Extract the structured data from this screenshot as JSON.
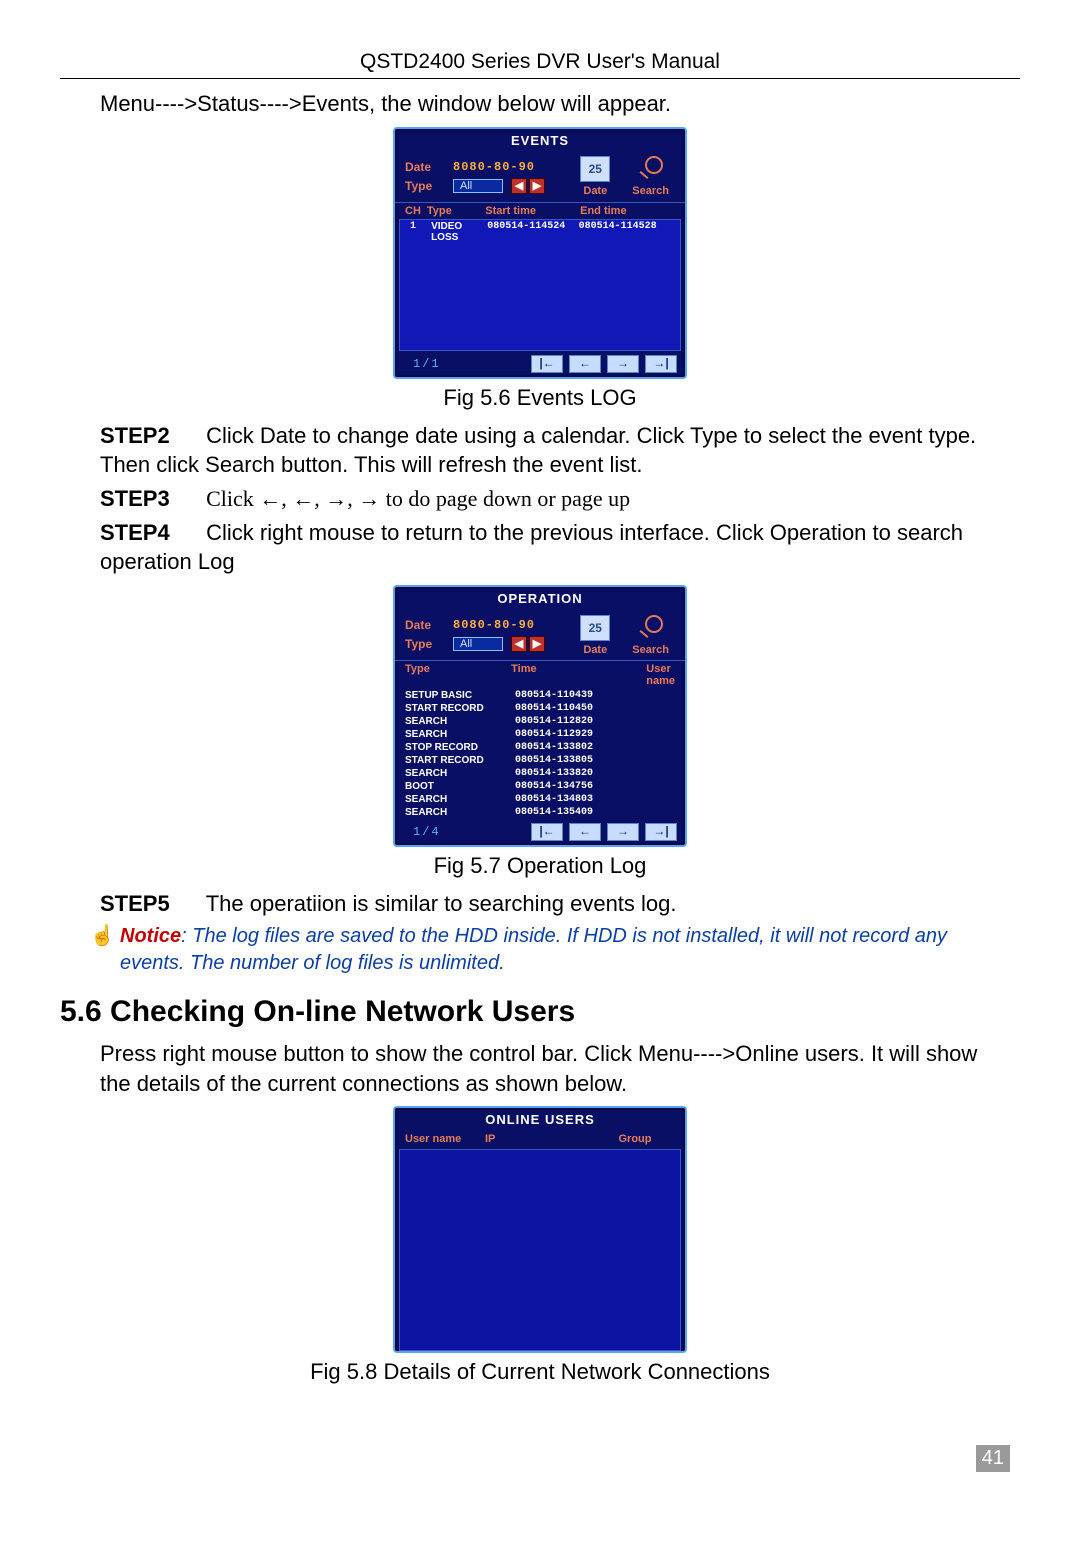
{
  "doc": {
    "header": "QSTD2400 Series DVR User's Manual",
    "intro": "Menu---->Status---->Events, the window below will appear.",
    "fig56": "Fig 5.6 Events LOG",
    "step2_label": "STEP2",
    "step2_text": "Click Date to change date using a calendar. Click Type to select the event type. Then click Search button. This will refresh the event list.",
    "step3_label": "STEP3",
    "step3_text_pre": "Click  ←,  ←,  →,  → ",
    "step3_text_post": "to do page down or page up",
    "step4_label": "STEP4",
    "step4_text": "Click right mouse to return to the previous interface. Click Operation to search operation Log",
    "fig57": "Fig 5.7 Operation Log",
    "step5_label": "STEP5",
    "step5_text": "The operatiion is similar to searching events log.",
    "notice_label": "Notice",
    "notice_text": ": The log files are saved to the HDD inside. If HDD is not installed, it will not record any events. The number of log files is unlimited.",
    "section_heading": "5.6  Checking On-line Network Users",
    "section_body": "Press right mouse button to show the control bar. Click Menu---->Online users. It will show the details of the current connections as shown below.",
    "fig58": "Fig 5.8 Details of Current Network Connections",
    "page_number": "41"
  },
  "events": {
    "title": "EVENTS",
    "date_label": "Date",
    "date_value": "8080-80-90",
    "type_label": "Type",
    "type_value": "All",
    "icon_date_value": "25",
    "icon_date_label": "Date",
    "icon_search_label": "Search",
    "cols": {
      "ch": "CH",
      "type": "Type",
      "start": "Start time",
      "end": "End time"
    },
    "row": {
      "ch": "1",
      "type": "VIDEO LOSS",
      "start": "080514-114524",
      "end": "080514-114528"
    },
    "page": "1/1"
  },
  "operation": {
    "title": "OPERATION",
    "date_label": "Date",
    "date_value": "8080-80-90",
    "type_label": "Type",
    "type_value": "All",
    "icon_date_value": "25",
    "icon_date_label": "Date",
    "icon_search_label": "Search",
    "cols": {
      "type": "Type",
      "time": "Time",
      "user": "User name"
    },
    "rows": [
      {
        "type": "SETUP BASIC",
        "time": "080514-110439",
        "user": ""
      },
      {
        "type": "START RECORD",
        "time": "080514-110450",
        "user": ""
      },
      {
        "type": "SEARCH",
        "time": "080514-112820",
        "user": ""
      },
      {
        "type": "SEARCH",
        "time": "080514-112929",
        "user": ""
      },
      {
        "type": "STOP RECORD",
        "time": "080514-133802",
        "user": ""
      },
      {
        "type": "START RECORD",
        "time": "080514-133805",
        "user": ""
      },
      {
        "type": "SEARCH",
        "time": "080514-133820",
        "user": ""
      },
      {
        "type": "BOOT",
        "time": "080514-134756",
        "user": ""
      },
      {
        "type": "SEARCH",
        "time": "080514-134803",
        "user": ""
      },
      {
        "type": "SEARCH",
        "time": "080514-135409",
        "user": ""
      }
    ],
    "page": "1/4"
  },
  "online": {
    "title": "ONLINE USERS",
    "cols": {
      "user": "User name",
      "ip": "IP",
      "group": "Group"
    }
  },
  "nav": {
    "first": "|←",
    "prev": "←",
    "next": "→",
    "last": "→|"
  }
}
